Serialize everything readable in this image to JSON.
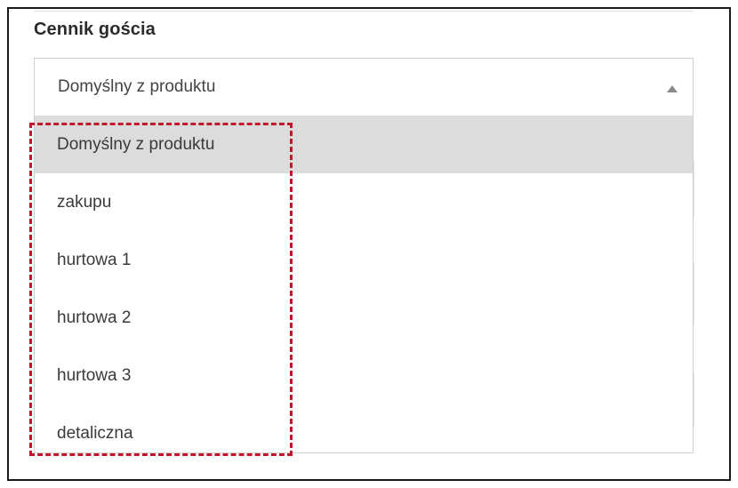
{
  "field": {
    "label": "Cennik gościa",
    "selected_value": "Domyślny z produktu"
  },
  "dropdown": {
    "options": [
      {
        "label": "Domyślny z produktu",
        "selected": true
      },
      {
        "label": "zakupu",
        "selected": false
      },
      {
        "label": "hurtowa 1",
        "selected": false
      },
      {
        "label": "hurtowa 2",
        "selected": false
      },
      {
        "label": "hurtowa 3",
        "selected": false
      },
      {
        "label": "detaliczna",
        "selected": false
      }
    ]
  },
  "icons": {
    "select_caret": "caret-up-icon"
  },
  "colors": {
    "highlight": "#c0172a",
    "selected_option_bg": "#dcdcdc"
  }
}
